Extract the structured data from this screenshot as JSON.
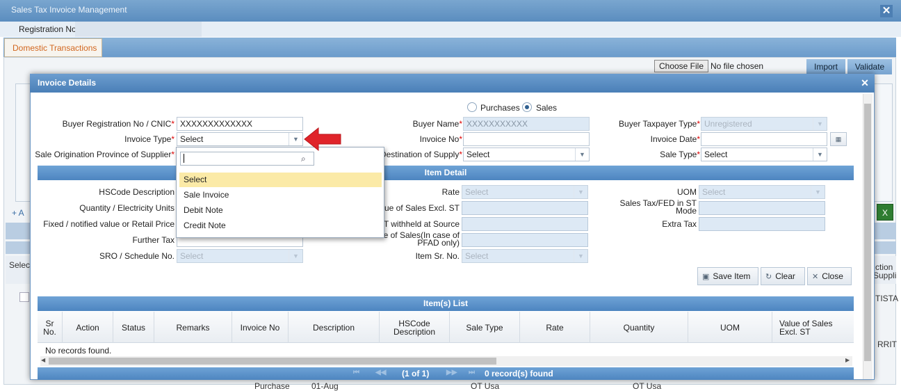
{
  "background": {
    "window_title": "Sales Tax Invoice Management",
    "registration_label": "Registration No",
    "tab_label": "Domestic Transactions",
    "choose_file_label": "Choose File",
    "no_file_text": "No file chosen",
    "import_label": "Import",
    "validate_label": "Validate",
    "side_select": "Selec",
    "side_add": "+ A",
    "right_col_1": "ction",
    "right_col_2": "Suppli",
    "right_text_1": "TISTA",
    "right_text_2": "RRIT",
    "bottom_text_1": "Purchase",
    "bottom_text_2": "01-Aug",
    "bottom_text_3": "OT Usa",
    "bottom_text_4": "OT Usa"
  },
  "dialog": {
    "title": "Invoice Details",
    "radio_purchases": "Purchases",
    "radio_sales": "Sales",
    "selected_mode": "Sales",
    "fields": {
      "buyer_reg_label": "Buyer Registration No / CNIC",
      "buyer_reg_value": "XXXXXXXXXXXXX",
      "invoice_type_label": "Invoice Type",
      "invoice_type_value": "Select",
      "origin_province_label": "Sale Origination Province of Supplier",
      "buyer_name_label": "Buyer Name",
      "buyer_name_value": "XXXXXXXXXXX",
      "invoice_no_label": "Invoice No",
      "destination_label": "Destination of Supply",
      "destination_value": "Select",
      "buyer_taxpayer_label": "Buyer Taxpayer Type",
      "buyer_taxpayer_value": "Unregistered",
      "invoice_date_label": "Invoice Date",
      "sale_type_label": "Sale Type",
      "sale_type_value": "Select"
    },
    "item_detail": {
      "title": "Item Detail",
      "hscode_label": "HSCode Description",
      "qty_label": "Quantity / Electricity Units",
      "fixed_label": "Fixed / notified value or Retail Price",
      "further_tax_label": "Further Tax",
      "sro_label": "SRO / Schedule No.",
      "sro_value": "Select",
      "rate_label": "Rate",
      "rate_value": "Select",
      "value_excl_label": "Value of Sales Excl. ST",
      "st_withheld_label": "ST withheld at Source",
      "total_value_label_1": "Total Value of Sales(In case of",
      "total_value_label_2": "PFAD only)",
      "item_sr_label": "Item Sr. No.",
      "item_sr_value": "Select",
      "uom_label": "UOM",
      "uom_value": "Select",
      "st_fed_label_1": "Sales Tax/FED in ST",
      "st_fed_label_2": "Mode",
      "extra_tax_label": "Extra Tax"
    },
    "buttons": {
      "save": "Save Item",
      "clear": "Clear",
      "close": "Close"
    },
    "items_list": {
      "title": "Item(s) List",
      "columns": [
        "Sr No.",
        "Action",
        "Status",
        "Remarks",
        "Invoice No",
        "Description",
        "HSCode Description",
        "Sale Type",
        "Rate",
        "Quantity",
        "UOM",
        "Value of Sales Excl. ST"
      ],
      "empty_text": "No records found.",
      "pager_text": "(1 of 1)",
      "records_text": "0 record(s) found"
    }
  },
  "dropdown": {
    "search_value": "",
    "options": [
      "Select",
      "Sale Invoice",
      "Debit Note",
      "Credit Note"
    ],
    "highlighted": "Select"
  },
  "colors": {
    "accent": "#4d85c0",
    "tab_text": "#d2661e",
    "highlight": "#fbeaa7",
    "pointer_arrow": "#e0242a"
  }
}
